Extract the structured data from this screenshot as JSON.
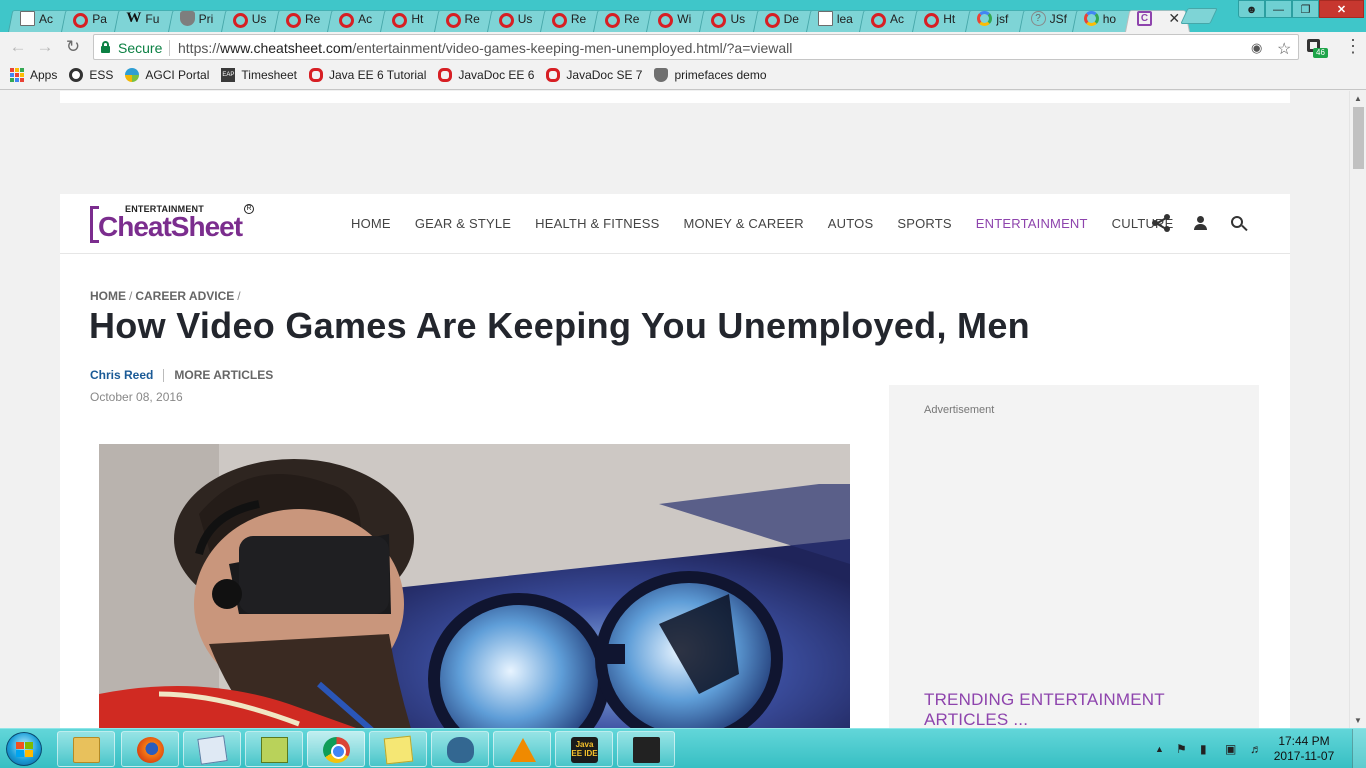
{
  "browser": {
    "tabs": [
      {
        "icon": "doc",
        "title": "Ac"
      },
      {
        "icon": "oracle",
        "title": "Pa"
      },
      {
        "icon": "wikipedia",
        "title": "Fu"
      },
      {
        "icon": "shield",
        "title": "Pri"
      },
      {
        "icon": "oracle",
        "title": "Us"
      },
      {
        "icon": "oracle",
        "title": "Re"
      },
      {
        "icon": "oracle",
        "title": "Ac"
      },
      {
        "icon": "oracle",
        "title": "Ht"
      },
      {
        "icon": "oracle",
        "title": "Re"
      },
      {
        "icon": "oracle",
        "title": "Us"
      },
      {
        "icon": "oracle",
        "title": "Re"
      },
      {
        "icon": "oracle",
        "title": "Re"
      },
      {
        "icon": "oracle",
        "title": "Wi"
      },
      {
        "icon": "oracle",
        "title": "Us"
      },
      {
        "icon": "oracle",
        "title": "De"
      },
      {
        "icon": "doc",
        "title": "lea"
      },
      {
        "icon": "oracle",
        "title": "Ac"
      },
      {
        "icon": "oracle",
        "title": "Ht"
      },
      {
        "icon": "google",
        "title": "jsf"
      },
      {
        "icon": "question",
        "title": "JSf"
      },
      {
        "icon": "google",
        "title": "ho"
      },
      {
        "icon": "cheatsheet",
        "title": "",
        "active": true,
        "close": "✕"
      }
    ],
    "address": {
      "secure_label": "Secure",
      "url_scheme": "https://",
      "url_host": "www.cheatsheet.com",
      "url_path": "/entertainment/video-games-keeping-men-unemployed.html/?a=viewall"
    },
    "extension_badge": "46",
    "bookmarks": [
      {
        "icon": "apps",
        "label": "Apps"
      },
      {
        "icon": "ess",
        "label": "ESS"
      },
      {
        "icon": "agci",
        "label": "AGCI Portal"
      },
      {
        "icon": "eap",
        "label": "Timesheet"
      },
      {
        "icon": "oracle",
        "label": "Java EE 6 Tutorial"
      },
      {
        "icon": "oracle",
        "label": "JavaDoc EE 6"
      },
      {
        "icon": "oracle",
        "label": "JavaDoc SE 7"
      },
      {
        "icon": "primefaces",
        "label": "primefaces demo"
      }
    ]
  },
  "site": {
    "logo_sub": "ENTERTAINMENT",
    "logo_main": "CheatSheet",
    "logo_reg": "R",
    "nav": [
      {
        "label": "HOME"
      },
      {
        "label": "GEAR & STYLE"
      },
      {
        "label": "HEALTH & FITNESS"
      },
      {
        "label": "MONEY & CAREER"
      },
      {
        "label": "AUTOS"
      },
      {
        "label": "SPORTS"
      },
      {
        "label": "ENTERTAINMENT",
        "active": true
      },
      {
        "label": "CULTURE"
      }
    ],
    "accent_color": "#8e44ad"
  },
  "article": {
    "breadcrumb": [
      "HOME",
      "CAREER ADVICE"
    ],
    "breadcrumb_sep": "/",
    "title": "How Video Games Are Keeping You Unemployed, Men",
    "author": "Chris Reed",
    "more_articles": "MORE ARTICLES",
    "date": "October 08, 2016"
  },
  "sidebar": {
    "ad_label": "Advertisement",
    "trending_heading": "TRENDING ENTERTAINMENT ARTICLES ..."
  },
  "taskbar": {
    "apps": [
      "file-explorer",
      "firefox",
      "notepad",
      "notepad-plus-plus",
      "chrome",
      "sticky-notes",
      "pgadmin",
      "vlc",
      "java-ee-ide",
      "inkscape"
    ],
    "active_app": "chrome",
    "javaee_label": "Java EE IDE",
    "clock_time": "17:44 PM",
    "clock_date": "2017-11-07"
  }
}
